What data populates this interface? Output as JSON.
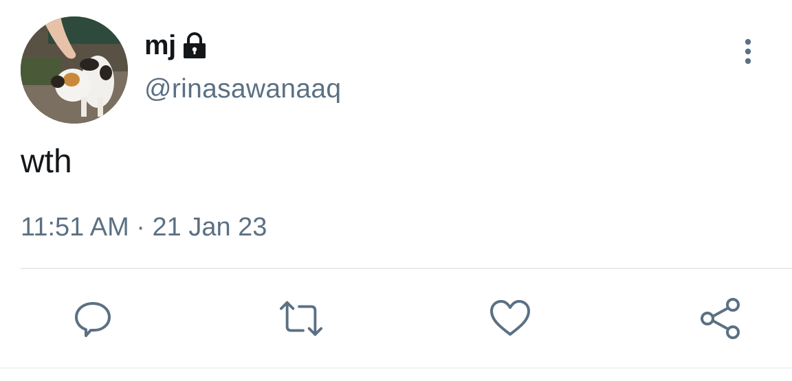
{
  "tweet": {
    "display_name": "mj",
    "handle": "@rinasawanaaq",
    "text": "wth",
    "time": "11:51 AM",
    "separator": "·",
    "date": "21 Jan 23",
    "protected": true
  },
  "icons": {
    "lock": "lock-icon",
    "more": "more-vertical-icon",
    "reply": "reply-icon",
    "retweet": "retweet-icon",
    "like": "heart-icon",
    "share": "share-icon"
  },
  "colors": {
    "text_primary": "#14171a",
    "text_secondary": "#5b7083",
    "divider": "#e6ecf0"
  }
}
